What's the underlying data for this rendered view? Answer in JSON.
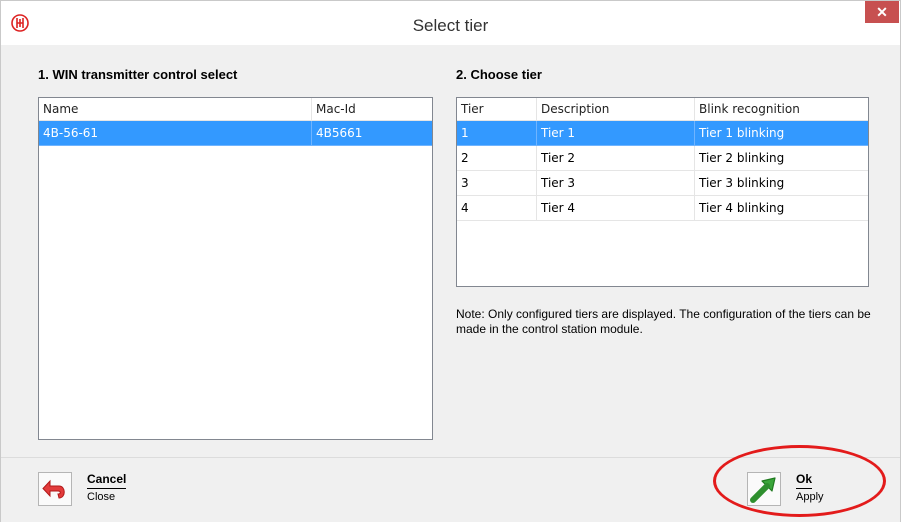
{
  "window": {
    "title": "Select tier",
    "close_glyph": "✕"
  },
  "left": {
    "section_title": "1. WIN transmitter control select",
    "columns": [
      "Name",
      "Mac-Id"
    ],
    "rows": [
      {
        "name": "4B-56-61",
        "mac": "4B5661",
        "selected": true
      }
    ]
  },
  "right": {
    "section_title": "2. Choose tier",
    "columns": [
      "Tier",
      "Description",
      "Blink recognition"
    ],
    "rows": [
      {
        "tier": "1",
        "description": "Tier 1",
        "blink": "Tier 1 blinking",
        "selected": true
      },
      {
        "tier": "2",
        "description": "Tier 2",
        "blink": "Tier 2 blinking"
      },
      {
        "tier": "3",
        "description": "Tier 3",
        "blink": "Tier 3 blinking"
      },
      {
        "tier": "4",
        "description": "Tier 4",
        "blink": "Tier 4 blinking"
      }
    ],
    "note": "Note: Only configured tiers are displayed. The configuration of the tiers can be made in the control station module."
  },
  "footer": {
    "cancel": {
      "label": "Cancel",
      "sub": "Close",
      "icon": "undo-arrow-icon"
    },
    "ok": {
      "label": "Ok",
      "sub": "Apply",
      "icon": "green-arrow-icon"
    }
  },
  "colors": {
    "selection": "#3399ff",
    "close": "#c75050",
    "highlight": "#e31b1b"
  }
}
